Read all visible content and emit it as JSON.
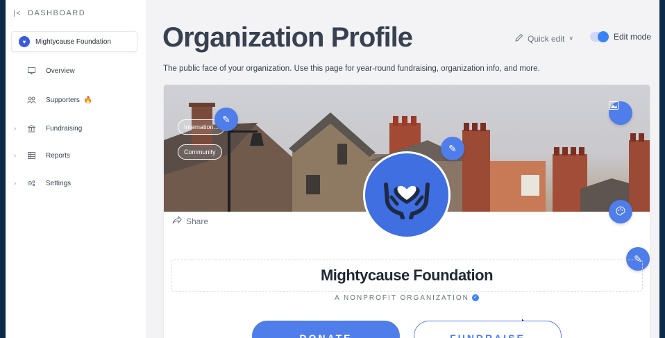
{
  "sidebar": {
    "header": "DASHBOARD",
    "org_name": "Mightycause Foundation",
    "items": [
      {
        "label": "Overview",
        "icon": "monitor-icon"
      },
      {
        "label": "Supporters",
        "icon": "people-icon"
      },
      {
        "label": "Fundraising",
        "icon": "bank-icon"
      },
      {
        "label": "Reports",
        "icon": "table-icon"
      },
      {
        "label": "Settings",
        "icon": "gear-icon"
      }
    ]
  },
  "main": {
    "title": "Organization Profile",
    "subtitle": "The public face of your organization. Use this page for year-round fundraising, organization info, and more.",
    "quick_edit": "Quick edit",
    "edit_mode": "Edit mode"
  },
  "profile": {
    "tags": [
      "Internation...",
      "Community"
    ],
    "share": "Share",
    "org_name": "Mightycause Foundation",
    "org_type": "A NONPROFIT ORGANIZATION",
    "donate": "DONATE",
    "fundraise": "FUNDRAISE"
  },
  "colors": {
    "accent": "#4f7de9",
    "logo_bg": "#3f6fe0"
  }
}
